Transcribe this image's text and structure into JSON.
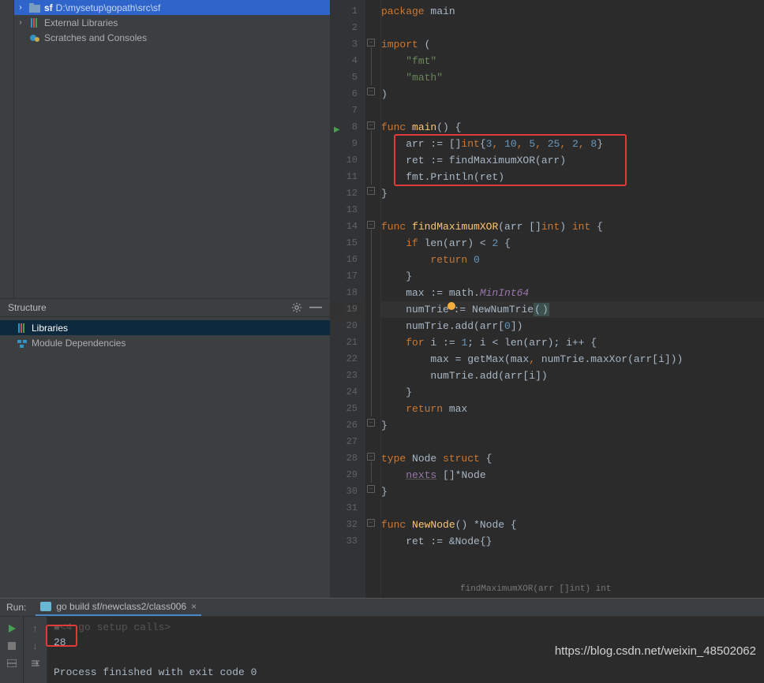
{
  "project_tree": {
    "items": [
      {
        "name": "sf",
        "path": "D:\\mysetup\\gopath\\src\\sf",
        "selected": true
      },
      {
        "name": "External Libraries"
      },
      {
        "name": "Scratches and Consoles"
      }
    ]
  },
  "structure": {
    "title": "Structure",
    "items": [
      {
        "name": "Libraries",
        "selected": true
      },
      {
        "name": "Module Dependencies"
      }
    ]
  },
  "editor": {
    "lines": [
      "package main",
      "",
      "import (",
      "    \"fmt\"",
      "    \"math\"",
      ")",
      "",
      "func main() {",
      "    arr := []int{3, 10, 5, 25, 2, 8}",
      "    ret := findMaximumXOR(arr)",
      "    fmt.Println(ret)",
      "}",
      "",
      "func findMaximumXOR(arr []int) int {",
      "    if len(arr) < 2 {",
      "        return 0",
      "    }",
      "    max := math.MinInt64",
      "    numTrie := NewNumTrie()",
      "    numTrie.add(arr[0])",
      "    for i := 1; i < len(arr); i++ {",
      "        max = getMax(max, numTrie.maxXor(arr[i]))",
      "        numTrie.add(arr[i])",
      "    }",
      "    return max",
      "}",
      "",
      "type Node struct {",
      "    nexts []*Node",
      "}",
      "",
      "func NewNode() *Node {",
      "    ret := &Node{}"
    ],
    "line_start": 1,
    "breadcrumb": "findMaximumXOR(arr []int) int"
  },
  "run": {
    "label": "Run:",
    "tab": "go build sf/newclass2/class006",
    "output": [
      "<4 go setup calls>",
      "28",
      "",
      "Process finished with exit code 0"
    ]
  },
  "watermark": "https://blog.csdn.net/weixin_48502062"
}
